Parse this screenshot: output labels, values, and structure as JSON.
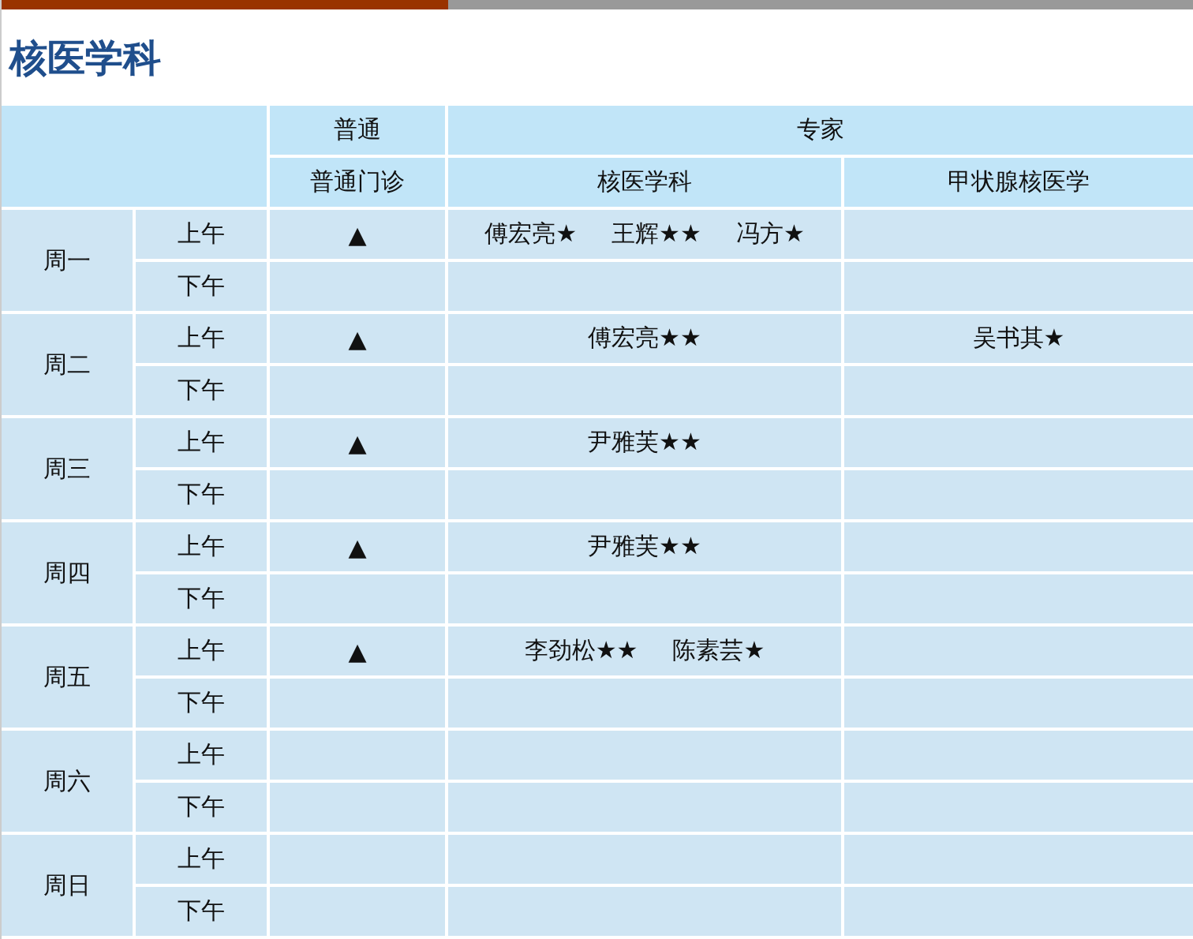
{
  "title": "核医学科",
  "header": {
    "groups": [
      {
        "label": "普通",
        "columns": [
          "普通门诊"
        ]
      },
      {
        "label": "专家",
        "columns": [
          "核医学科",
          "甲状腺核医学"
        ]
      }
    ]
  },
  "days": [
    {
      "day": "周一",
      "slots": [
        {
          "period": "上午",
          "general": "▲",
          "nuclear": [
            "傅宏亮★",
            "王辉★★",
            "冯方★"
          ]
        },
        {
          "period": "下午"
        }
      ]
    },
    {
      "day": "周二",
      "slots": [
        {
          "period": "上午",
          "general": "▲",
          "nuclear": [
            "傅宏亮★★"
          ],
          "thyroid": [
            "吴书其★"
          ]
        },
        {
          "period": "下午"
        }
      ]
    },
    {
      "day": "周三",
      "slots": [
        {
          "period": "上午",
          "general": "▲",
          "nuclear": [
            "尹雅芙★★"
          ]
        },
        {
          "period": "下午"
        }
      ]
    },
    {
      "day": "周四",
      "slots": [
        {
          "period": "上午",
          "general": "▲",
          "nuclear": [
            "尹雅芙★★"
          ]
        },
        {
          "period": "下午"
        }
      ]
    },
    {
      "day": "周五",
      "slots": [
        {
          "period": "上午",
          "general": "▲",
          "nuclear": [
            "李劲松★★",
            "陈素芸★"
          ]
        },
        {
          "period": "下午"
        }
      ]
    },
    {
      "day": "周六",
      "slots": [
        {
          "period": "上午"
        },
        {
          "period": "下午"
        }
      ]
    },
    {
      "day": "周日",
      "slots": [
        {
          "period": "上午"
        },
        {
          "period": "下午"
        }
      ]
    }
  ]
}
